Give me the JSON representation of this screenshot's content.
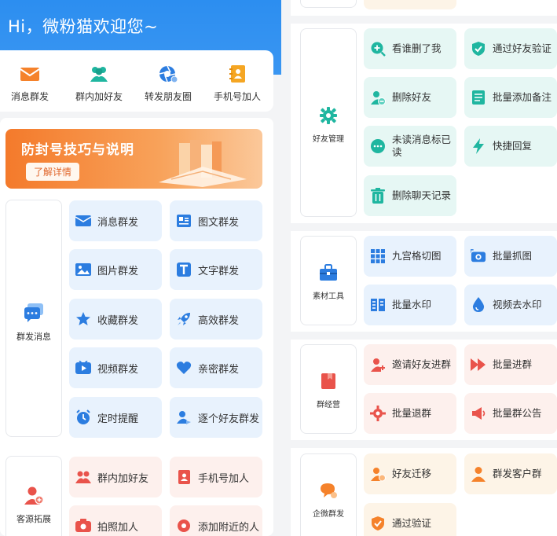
{
  "header": {
    "greeting": "Hi，微粉猫欢迎您~"
  },
  "quick_actions": [
    {
      "label": "消息群发",
      "icon": "mail-icon",
      "color": "#f5822b"
    },
    {
      "label": "群内加好友",
      "icon": "group-people-icon",
      "color": "#1fb6a0"
    },
    {
      "label": "转发朋友圈",
      "icon": "camera-shutter-icon",
      "color": "#2c7de0"
    },
    {
      "label": "手机号加人",
      "icon": "contact-book-icon",
      "color": "#f5a623"
    }
  ],
  "banner": {
    "title": "防封号技巧与说明",
    "button": "了解详情"
  },
  "left_groups": {
    "mass_send": {
      "label": "群发消息",
      "items": [
        "消息群发",
        "图文群发",
        "图片群发",
        "文字群发",
        "收藏群发",
        "高效群发",
        "视频群发",
        "亲密群发",
        "定时提醒",
        "逐个好友群发"
      ]
    },
    "customer": {
      "label": "客源拓展",
      "items": [
        "群内加好友",
        "手机号加人",
        "拍照加人",
        "添加附近的人"
      ]
    }
  },
  "right_groups": {
    "friend_mgmt": {
      "label": "好友管理",
      "items": [
        "看谁删了我",
        "通过好友验证",
        "删除好友",
        "批量添加备注",
        "未读消息标已读",
        "快捷回复",
        "删除聊天记录"
      ]
    },
    "material": {
      "label": "素材工具",
      "items": [
        "九宫格切图",
        "批量抓图",
        "批量水印",
        "视频去水印"
      ]
    },
    "group_ops": {
      "label": "群经营",
      "items": [
        "邀请好友进群",
        "批量进群",
        "批量退群",
        "批量群公告"
      ]
    },
    "wecom": {
      "label": "企微群发",
      "items": [
        "好友迁移",
        "群发客户群",
        "通过验证"
      ]
    }
  },
  "colors": {
    "header_blue": "#2c8ef0",
    "teal": "#1fb6a0",
    "blue": "#2c7de0",
    "red": "#e9534b",
    "orange": "#f5822b"
  }
}
